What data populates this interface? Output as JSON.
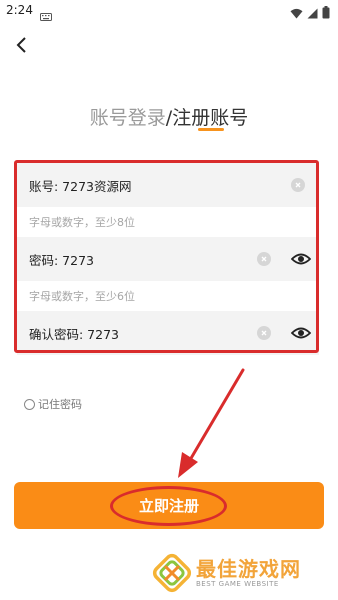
{
  "status_bar": {
    "time": "2:24"
  },
  "tabs": {
    "login": "账号登录",
    "separator": "/",
    "register": "注册账号"
  },
  "form": {
    "account": {
      "value": "账号: 7273资源网",
      "hint": "字母或数字，至少8位"
    },
    "password": {
      "value": "密码: 7273",
      "hint": "字母或数字，至少6位"
    },
    "confirm": {
      "value": "确认密码: 7273"
    }
  },
  "remember_label": "记住密码",
  "submit_label": "立即注册",
  "watermark": {
    "cn": "最佳游戏网",
    "en": "BEST GAME WEBSITE"
  },
  "colors": {
    "accent": "#fa8c16",
    "annotation": "#d92c2c"
  }
}
